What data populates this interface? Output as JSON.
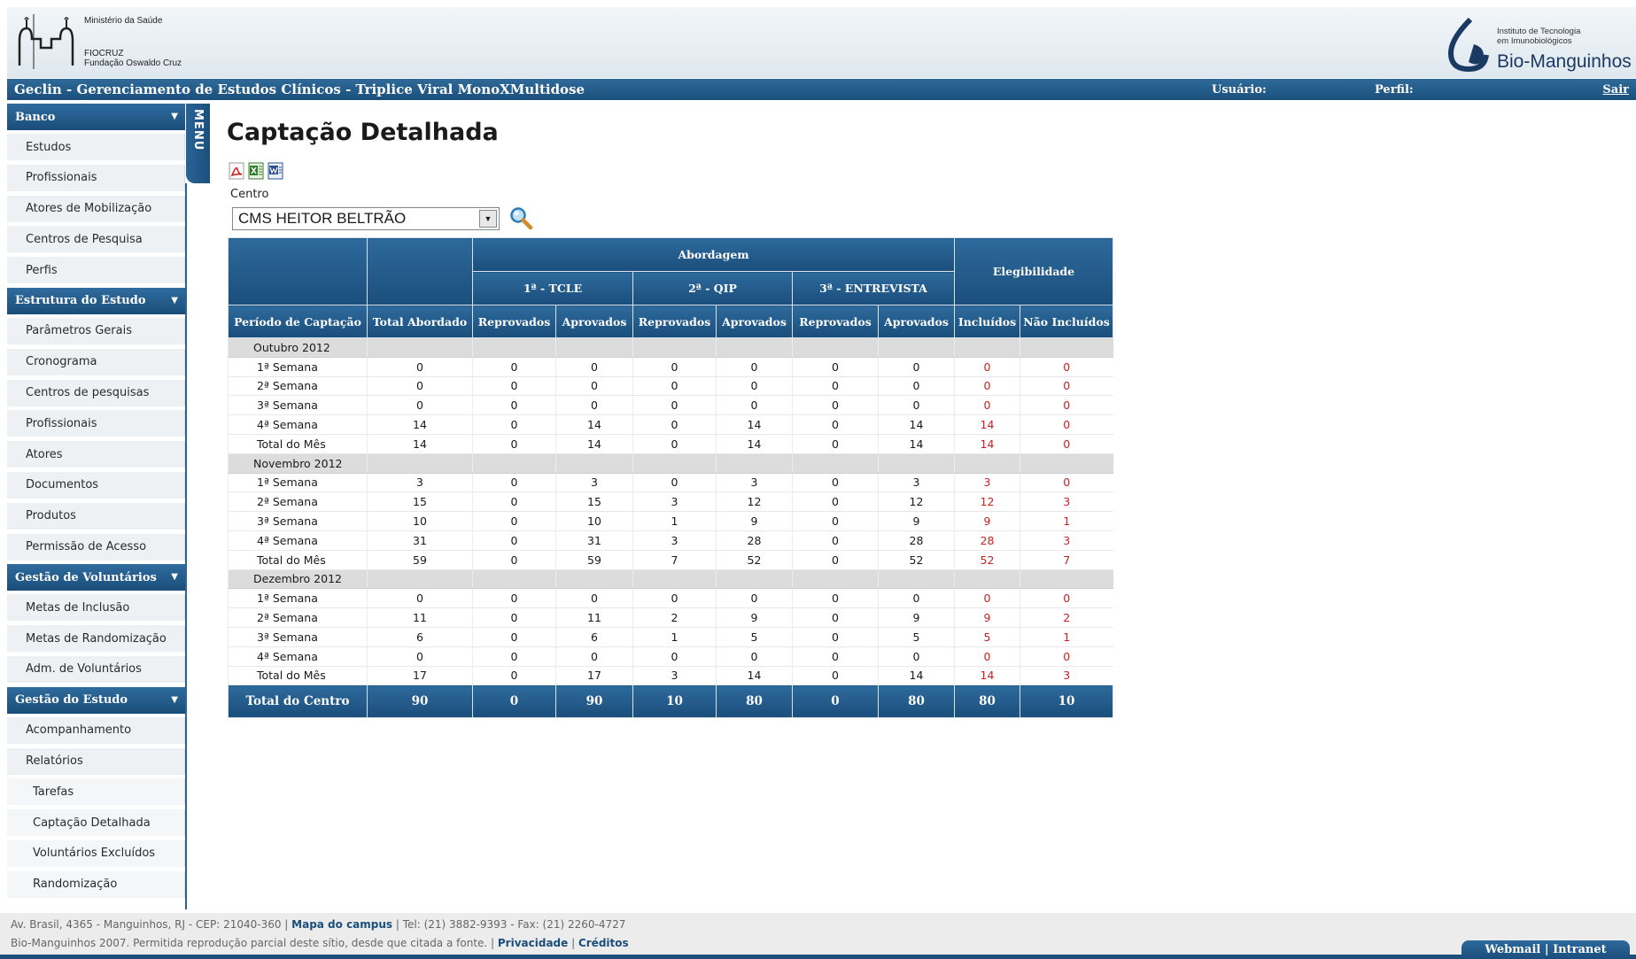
{
  "banner": {
    "ministry": "Ministério da Saúde",
    "org_name": "FIOCRUZ",
    "org_full": "Fundação Oswaldo Cruz",
    "institute_line1": "Instituto de Tecnologia",
    "institute_line2": "em Imunobiológicos",
    "institute_name": "Bio-Manguinhos"
  },
  "header": {
    "title": "Geclin - Gerenciamento de Estudos Clínicos  - Triplice Viral MonoXMultidose",
    "user_label": "Usuário:",
    "profile_label": "Perfil:",
    "logout": "Sair"
  },
  "sidebar": {
    "menu_tab": "MENU",
    "sections": [
      {
        "title": "Banco",
        "items": [
          "Estudos",
          "Profissionais",
          "Atores de Mobilização",
          "Centros de Pesquisa",
          "Perfis"
        ]
      },
      {
        "title": "Estrutura do Estudo",
        "items": [
          "Parâmetros Gerais",
          "Cronograma",
          "Centros de pesquisas",
          "Profissionais",
          "Atores",
          "Documentos",
          "Produtos",
          "Permissão de Acesso"
        ]
      },
      {
        "title": "Gestão de Voluntários",
        "items": [
          "Metas de Inclusão",
          "Metas de Randomização",
          "Adm. de Voluntários"
        ]
      },
      {
        "title": "Gestão do Estudo",
        "items": [
          "Acompanhamento",
          "Relatórios"
        ],
        "subitems": [
          "Tarefas",
          "Captação Detalhada",
          "Voluntários Excluídos",
          "Randomização"
        ]
      }
    ]
  },
  "main": {
    "page_title": "Captação Detalhada",
    "export_icons": [
      "pdf-icon",
      "excel-icon",
      "word-icon"
    ],
    "centro_label": "Centro",
    "centro_value": "CMS HEITOR BELTRÃO"
  },
  "table": {
    "group_abordagem": "Abordagem",
    "group_elegibilidade": "Elegibilidade",
    "sub_groups": [
      "1ª - TCLE",
      "2ª - QIP",
      "3ª - ENTREVISTA"
    ],
    "columns": [
      "Período de Captação",
      "Total Abordado",
      "Reprovados",
      "Aprovados",
      "Reprovados",
      "Aprovados",
      "Reprovados",
      "Aprovados",
      "Incluídos",
      "Não Incluídos"
    ],
    "months": [
      {
        "name": "Outubro 2012",
        "rows": [
          [
            "1ª Semana",
            "0",
            "0",
            "0",
            "0",
            "0",
            "0",
            "0",
            "0",
            "0"
          ],
          [
            "2ª Semana",
            "0",
            "0",
            "0",
            "0",
            "0",
            "0",
            "0",
            "0",
            "0"
          ],
          [
            "3ª Semana",
            "0",
            "0",
            "0",
            "0",
            "0",
            "0",
            "0",
            "0",
            "0"
          ],
          [
            "4ª Semana",
            "14",
            "0",
            "14",
            "0",
            "14",
            "0",
            "14",
            "14",
            "0"
          ],
          [
            "Total do Mês",
            "14",
            "0",
            "14",
            "0",
            "14",
            "0",
            "14",
            "14",
            "0"
          ]
        ]
      },
      {
        "name": "Novembro 2012",
        "rows": [
          [
            "1ª Semana",
            "3",
            "0",
            "3",
            "0",
            "3",
            "0",
            "3",
            "3",
            "0"
          ],
          [
            "2ª Semana",
            "15",
            "0",
            "15",
            "3",
            "12",
            "0",
            "12",
            "12",
            "3"
          ],
          [
            "3ª Semana",
            "10",
            "0",
            "10",
            "1",
            "9",
            "0",
            "9",
            "9",
            "1"
          ],
          [
            "4ª Semana",
            "31",
            "0",
            "31",
            "3",
            "28",
            "0",
            "28",
            "28",
            "3"
          ],
          [
            "Total do Mês",
            "59",
            "0",
            "59",
            "7",
            "52",
            "0",
            "52",
            "52",
            "7"
          ]
        ]
      },
      {
        "name": "Dezembro 2012",
        "rows": [
          [
            "1ª Semana",
            "0",
            "0",
            "0",
            "0",
            "0",
            "0",
            "0",
            "0",
            "0"
          ],
          [
            "2ª Semana",
            "11",
            "0",
            "11",
            "2",
            "9",
            "0",
            "9",
            "9",
            "2"
          ],
          [
            "3ª Semana",
            "6",
            "0",
            "6",
            "1",
            "5",
            "0",
            "5",
            "5",
            "1"
          ],
          [
            "4ª Semana",
            "0",
            "0",
            "0",
            "0",
            "0",
            "0",
            "0",
            "0",
            "0"
          ],
          [
            "Total do Mês",
            "17",
            "0",
            "17",
            "3",
            "14",
            "0",
            "14",
            "14",
            "3"
          ]
        ]
      }
    ],
    "total_row": [
      "Total do Centro",
      "90",
      "0",
      "90",
      "10",
      "80",
      "0",
      "80",
      "80",
      "10"
    ]
  },
  "footer": {
    "address_prefix": "Av. Brasil, 4365 - Manguinhos, RJ - CEP: 21040-360 | ",
    "map_link": "Mapa do campus",
    "contact": " | Tel: (21) 3882-9393 - Fax: (21) 2260-4727",
    "copyright": "Bio-Manguinhos 2007. Permitida reprodução parcial deste sítio, desde que citada a fonte. | ",
    "privacy": "Privacidade",
    "separator": " | ",
    "credits": "Créditos",
    "links": "Webmail | Intranet"
  },
  "colors": {
    "primary": "#1b4e7b",
    "accent_red": "#cc1e1e",
    "month_row": "#dcdcdc"
  }
}
